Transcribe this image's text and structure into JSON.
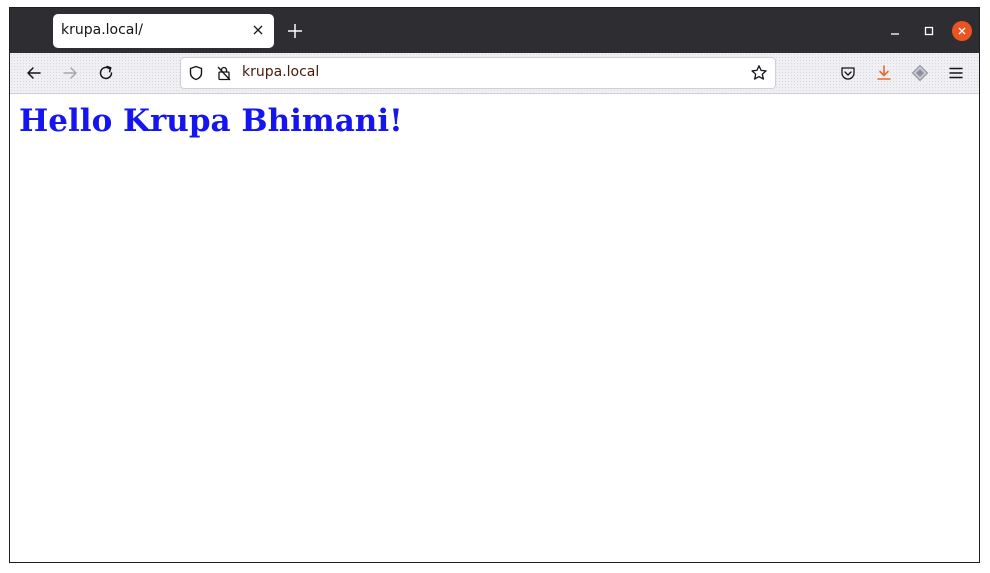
{
  "browser": {
    "tab": {
      "title": "krupa.local/"
    },
    "address_bar": {
      "url_text": "krupa.local"
    },
    "icons": {
      "tab_close": "close-icon",
      "new_tab": "plus-icon",
      "back": "arrow-left-icon",
      "forward": "arrow-right-icon",
      "reload": "reload-icon",
      "tracking_protection": "shield-icon",
      "connection": "lock-icon",
      "bookmark": "star-icon",
      "pocket": "pocket-icon",
      "downloads": "download-icon",
      "extensions": "extension-icon",
      "menu": "hamburger-menu-icon",
      "minimize": "minimize-icon",
      "maximize": "maximize-icon",
      "close_window": "close-window-icon"
    },
    "colors": {
      "titlebar": "#2e2d32",
      "close_button": "#e95420",
      "download_icon": "#e66a2c"
    }
  },
  "page": {
    "heading": "Hello Krupa Bhimani!",
    "heading_color": "#1515f0"
  }
}
